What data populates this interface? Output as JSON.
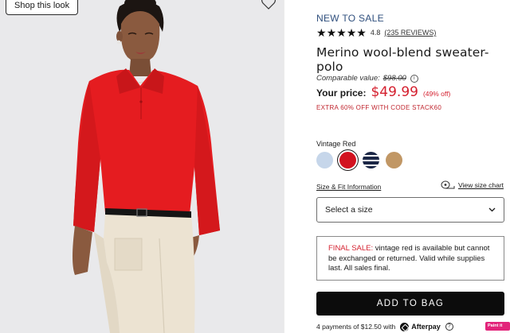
{
  "photo": {
    "shop_look_label": "Shop this look"
  },
  "product": {
    "badge": "NEW TO SALE",
    "rating_value": "4.8",
    "reviews_label": "(235 REVIEWS)",
    "stars": 5,
    "title": "Merino wool-blend sweater-polo",
    "comparable_label": "Comparable value:",
    "comparable_price": "$98.00",
    "your_price_label": "Your price:",
    "price": "$49.99",
    "discount": "(49% off)",
    "promo": "EXTRA 60% OFF WITH CODE STACK60",
    "color_label": "Vintage Red",
    "swatches": [
      {
        "name": "light-blue",
        "color": "#c6d6ea"
      },
      {
        "name": "vintage-red",
        "color": "#d2121f",
        "selected": true
      },
      {
        "name": "navy-stripe",
        "color": "#1c2746"
      },
      {
        "name": "camel",
        "color": "#c19765"
      }
    ],
    "size_fit_link": "Size & Fit Information",
    "size_chart_link": "View size chart",
    "size_select_value": "Select a size",
    "final_sale_prefix": "FINAL SALE:",
    "final_sale_text": " vintage red is available but cannot be exchanged or returned. Valid while supplies last. All sales final.",
    "add_to_bag": "ADD TO BAG",
    "afterpay_text": "4 payments of $12.50 with",
    "afterpay_brand": "Afterpay",
    "paint_it_badge": "Paint it Up"
  },
  "colors": {
    "accent_red": "#d41f2e",
    "badge_blue": "#2f4f7d",
    "button_black": "#0c0c0c"
  }
}
